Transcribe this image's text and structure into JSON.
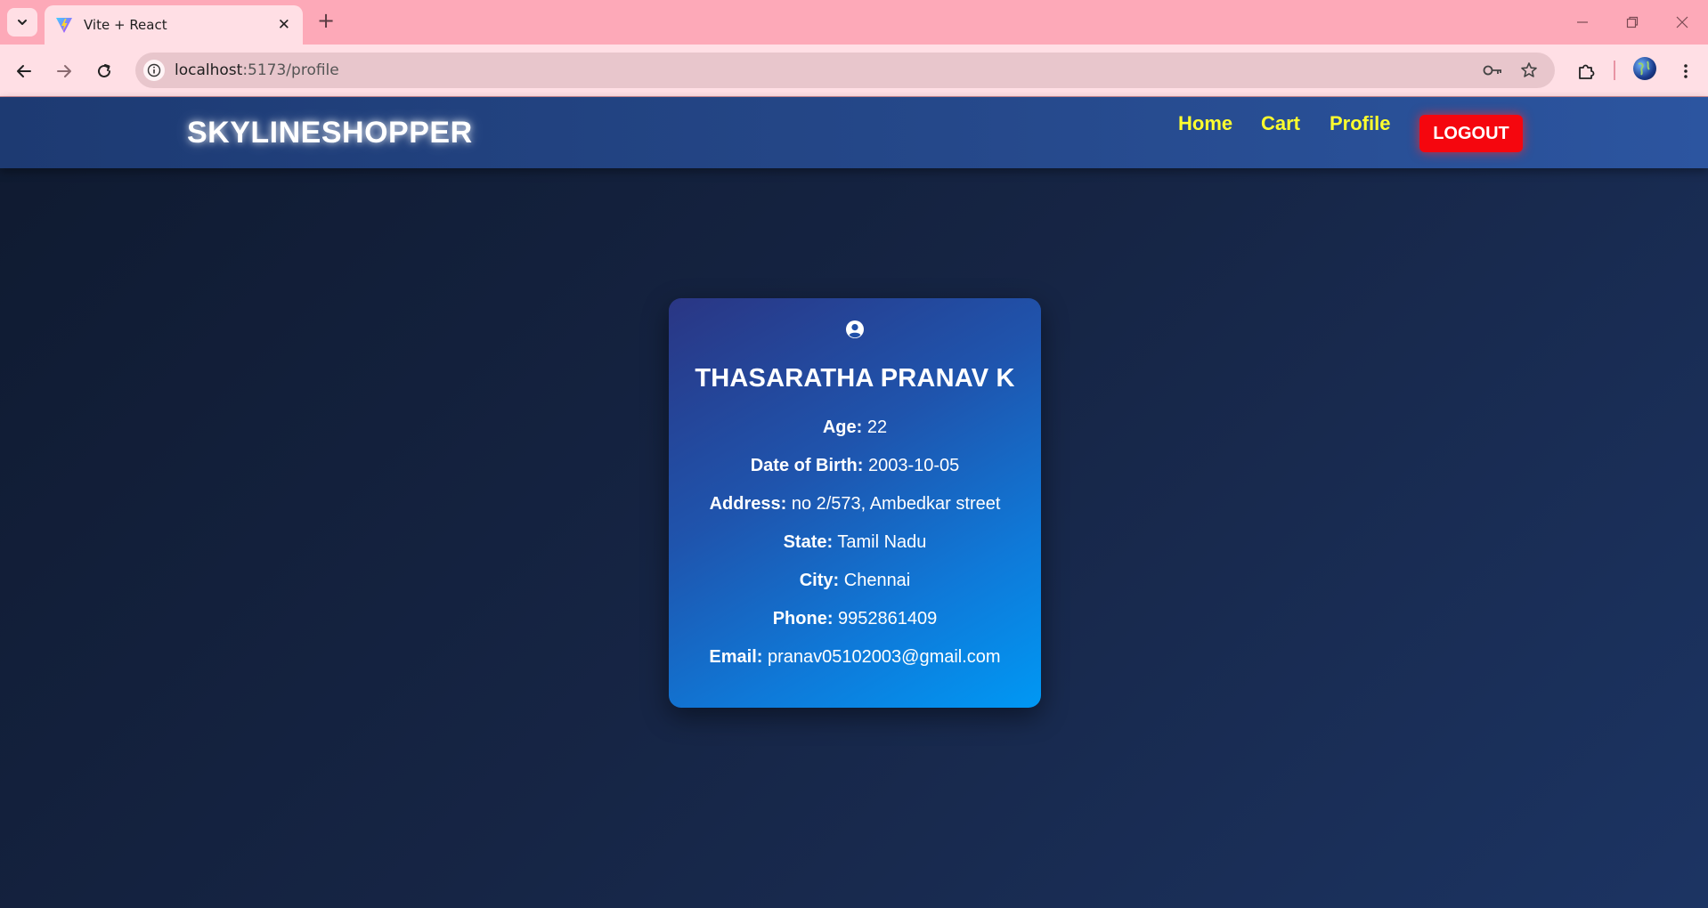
{
  "browser": {
    "tab_title": "Vite + React",
    "url_host": "localhost",
    "url_path": ":5173/profile"
  },
  "navbar": {
    "brand": "SKYLINESHOPPER",
    "links": [
      "Home",
      "Cart",
      "Profile"
    ],
    "logout_label": "LOGOUT"
  },
  "profile": {
    "name": "THASARATHA PRANAV K",
    "fields": [
      {
        "label": "Age:",
        "value": "22"
      },
      {
        "label": "Date of Birth:",
        "value": "2003-10-05"
      },
      {
        "label": "Address:",
        "value": "no 2/573, Ambedkar street"
      },
      {
        "label": "State:",
        "value": "Tamil Nadu"
      },
      {
        "label": "City:",
        "value": "Chennai"
      },
      {
        "label": "Phone:",
        "value": "9952861409"
      },
      {
        "label": "Email:",
        "value": "pranav05102003@gmail.com"
      }
    ]
  },
  "colors": {
    "nav_link": "#ffff2e",
    "logout": "#f5060e",
    "tabstrip": "#fda9b8"
  },
  "icons": {
    "profile_card": "user-circle-icon",
    "tab_favicon": "vite-logo-icon"
  }
}
